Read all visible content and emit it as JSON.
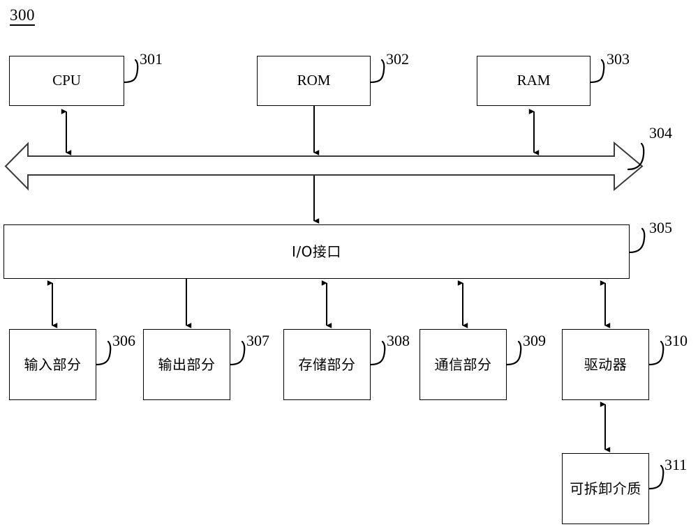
{
  "figure": {
    "number": "300",
    "caption_position": "top-left"
  },
  "blocks": [
    {
      "id": "cpu",
      "label": "CPU",
      "ref": "301",
      "script": "latin"
    },
    {
      "id": "rom",
      "label": "ROM",
      "ref": "302",
      "script": "latin"
    },
    {
      "id": "ram",
      "label": "RAM",
      "ref": "303",
      "script": "latin"
    },
    {
      "id": "bus",
      "label": "",
      "ref": "304",
      "script": "none"
    },
    {
      "id": "io",
      "label": "I/O接口",
      "ref": "305",
      "script": "cjk"
    },
    {
      "id": "input",
      "label": "输入部分",
      "ref": "306",
      "script": "cjk"
    },
    {
      "id": "output",
      "label": "输出部分",
      "ref": "307",
      "script": "cjk"
    },
    {
      "id": "storage",
      "label": "存储部分",
      "ref": "308",
      "script": "cjk"
    },
    {
      "id": "comm",
      "label": "通信部分",
      "ref": "309",
      "script": "cjk"
    },
    {
      "id": "driver",
      "label": "驱动器",
      "ref": "310",
      "script": "cjk"
    },
    {
      "id": "media",
      "label": "可拆卸介质",
      "ref": "311",
      "script": "cjk"
    }
  ],
  "labels": {
    "cpu": "CPU",
    "rom": "ROM",
    "ram": "RAM",
    "io": "I/O接口",
    "input": "输入部分",
    "output": "输出部分",
    "storage": "存储部分",
    "comm": "通信部分",
    "driver": "驱动器",
    "media": "可拆卸介质"
  },
  "refs": {
    "cpu": "301",
    "rom": "302",
    "ram": "303",
    "bus": "304",
    "io": "305",
    "input": "306",
    "output": "307",
    "storage": "308",
    "comm": "309",
    "driver": "310",
    "media": "311"
  },
  "connections": [
    {
      "from": "cpu",
      "to": "bus",
      "arrow": "bidirectional"
    },
    {
      "from": "rom",
      "to": "bus",
      "arrow": "down"
    },
    {
      "from": "ram",
      "to": "bus",
      "arrow": "bidirectional"
    },
    {
      "from": "bus",
      "to": "io",
      "arrow": "down"
    },
    {
      "from": "io",
      "to": "input",
      "arrow": "bidirectional"
    },
    {
      "from": "io",
      "to": "output",
      "arrow": "down"
    },
    {
      "from": "io",
      "to": "storage",
      "arrow": "bidirectional"
    },
    {
      "from": "io",
      "to": "comm",
      "arrow": "bidirectional"
    },
    {
      "from": "io",
      "to": "driver",
      "arrow": "bidirectional"
    },
    {
      "from": "driver",
      "to": "media",
      "arrow": "bidirectional"
    }
  ],
  "colors": {
    "stroke": "#000000",
    "bus_stroke": "#3a3a3a",
    "background": "#ffffff"
  }
}
